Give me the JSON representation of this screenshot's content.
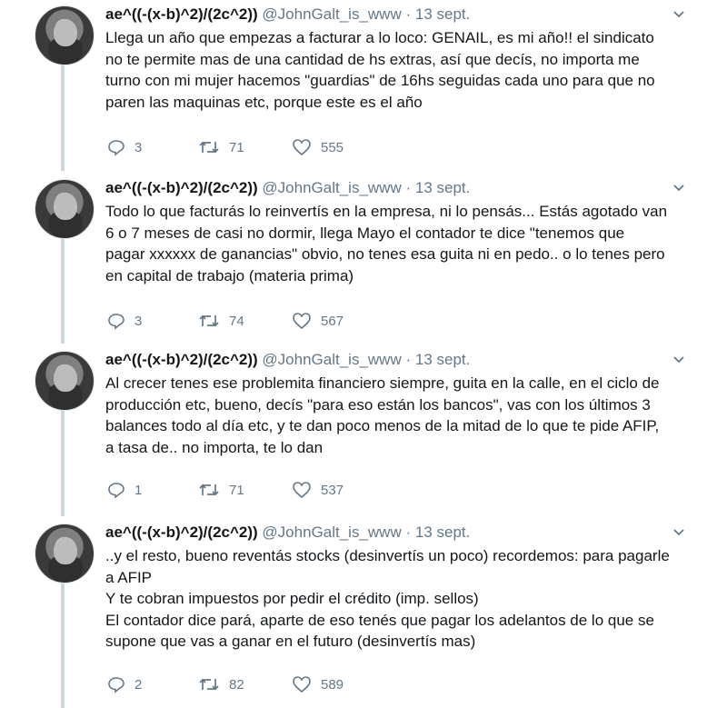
{
  "tweets": [
    {
      "name": "ae^((-(x-b)^2)/(2c^2))",
      "handle": "@JohnGalt_is_www",
      "separator": "·",
      "date": "13 sept.",
      "lines": [
        "Llega un año que empezas a facturar a lo loco: GENAIL, es mi año!! el sindicato",
        "no te permite mas de una cantidad de hs extras, así que decís, no importa me",
        "turno con mi mujer hacemos \"guardias\" de 16hs seguidas cada uno para que no",
        "paren las maquinas etc, porque este es el año"
      ],
      "replies": "3",
      "retweets": "71",
      "likes": "555"
    },
    {
      "name": "ae^((-(x-b)^2)/(2c^2))",
      "handle": "@JohnGalt_is_www",
      "separator": "·",
      "date": "13 sept.",
      "lines": [
        "Todo lo que facturás lo reinvertís en la empresa, ni lo pensás... Estás agotado van",
        "6 o 7 meses de casi no dormir, llega Mayo el contador te dice \"tenemos que",
        "pagar xxxxxx de ganancias\" obvio, no tenes esa guita ni en pedo.. o lo tenes pero",
        "en capital de trabajo (materia prima)"
      ],
      "replies": "3",
      "retweets": "74",
      "likes": "567"
    },
    {
      "name": "ae^((-(x-b)^2)/(2c^2))",
      "handle": "@JohnGalt_is_www",
      "separator": "·",
      "date": "13 sept.",
      "lines": [
        "Al crecer tenes ese problemita financiero siempre, guita en la calle, en el ciclo de",
        "producción etc, bueno, decís \"para eso están los bancos\", vas con los últimos 3",
        "balances todo al día etc, y te dan poco menos de la mitad de lo que te pide AFIP,",
        "a tasa de.. no importa, te lo dan"
      ],
      "replies": "1",
      "retweets": "71",
      "likes": "537"
    },
    {
      "name": "ae^((-(x-b)^2)/(2c^2))",
      "handle": "@JohnGalt_is_www",
      "separator": "·",
      "date": "13 sept.",
      "lines": [
        "..y el resto, bueno reventás stocks (desinvertís un poco) recordemos: para pagarle",
        "a AFIP",
        "Y te cobran impuestos por pedir el crédito (imp. sellos)",
        "El contador dice pará, aparte de eso tenés que pagar los adelantos de lo que se",
        "supone que vas a ganar en el futuro (desinvertís mas)"
      ],
      "replies": "2",
      "retweets": "82",
      "likes": "589"
    }
  ]
}
